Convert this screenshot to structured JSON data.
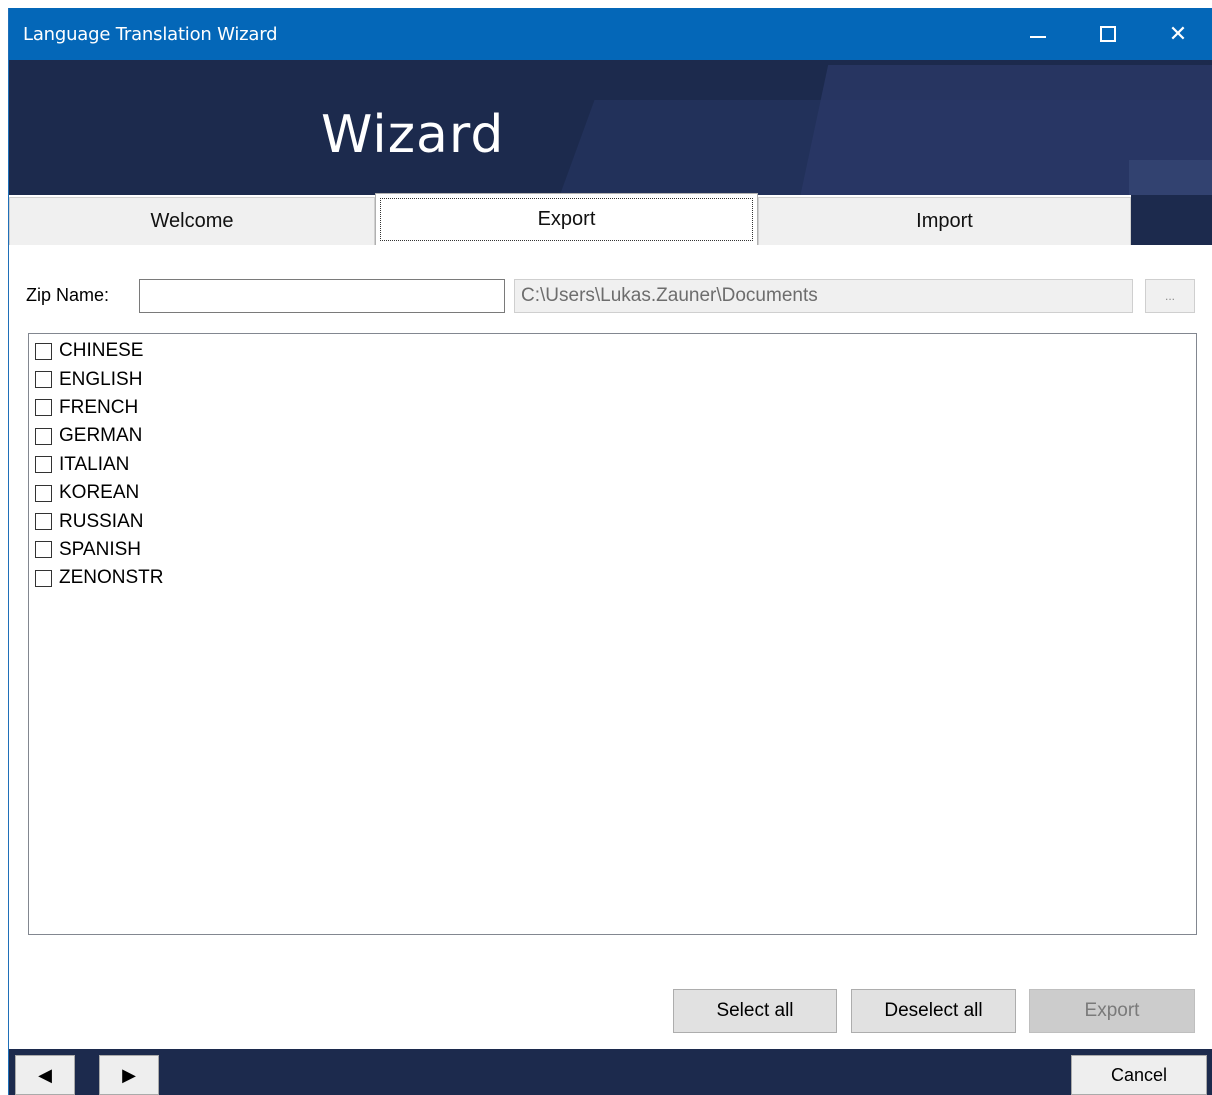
{
  "window": {
    "title": "Language Translation Wizard",
    "minimize_label": "—",
    "close_label": "✕"
  },
  "banner": {
    "title": "Wizard"
  },
  "tabs": [
    {
      "label": "Welcome",
      "selected": false
    },
    {
      "label": "Export",
      "selected": true
    },
    {
      "label": "Import",
      "selected": false
    }
  ],
  "export": {
    "zip_label": "Zip Name:",
    "zip_value": "",
    "path_value": "C:\\Users\\Lukas.Zauner\\Documents",
    "browse_label": "...",
    "languages": [
      {
        "label": "CHINESE",
        "checked": false
      },
      {
        "label": "ENGLISH",
        "checked": false
      },
      {
        "label": "FRENCH",
        "checked": false
      },
      {
        "label": "GERMAN",
        "checked": false
      },
      {
        "label": "ITALIAN",
        "checked": false
      },
      {
        "label": "KOREAN",
        "checked": false
      },
      {
        "label": "RUSSIAN",
        "checked": false
      },
      {
        "label": "SPANISH",
        "checked": false
      },
      {
        "label": "ZENONSTR",
        "checked": false
      }
    ],
    "select_all_label": "Select all",
    "deselect_all_label": "Deselect all",
    "export_label": "Export"
  },
  "footer": {
    "prev_label": "◀",
    "next_label": "▶",
    "cancel_label": "Cancel"
  },
  "colors": {
    "titlebar": "#0467b8",
    "banner": "#1c2a4d"
  }
}
